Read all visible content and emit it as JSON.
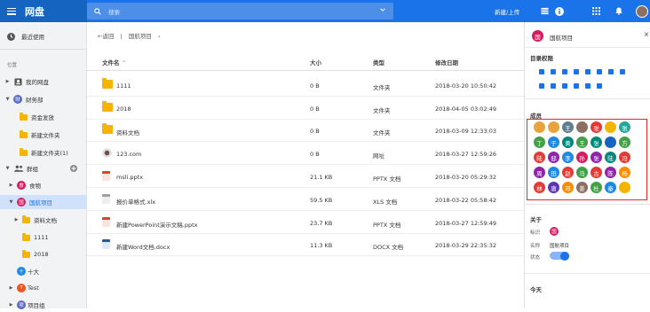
{
  "app": {
    "name": "网盘",
    "search_placeholder": "搜索",
    "new_upload": "新建/上传"
  },
  "colors": {
    "topbar": "#1a73e8",
    "accent": "#1a73e8",
    "folder": "#f4b400",
    "selection": "#cfe1fb",
    "highlight_box": "#d93025"
  },
  "sidebar": {
    "recent": "最近使用",
    "location_label": "位置",
    "my_drive": "我的网盘",
    "dept_avatar": "财",
    "dept": "财务部",
    "dept_folders": [
      "资金发放",
      "新建文件夹",
      "新建文件夹(1)"
    ],
    "groups": "群组",
    "g_shiwu_avatar": "食",
    "g_shiwu": "食物",
    "g_guohang_avatar": "国",
    "g_guohang": "国航项目",
    "sub_folders": [
      "资料文档",
      "1111",
      "2018"
    ],
    "g_shida_avatar": "十",
    "g_shida": "十大",
    "g_test_avatar": "T",
    "g_test": "Test",
    "g_xiangmu_avatar": "项",
    "g_xiangmu": "项目组"
  },
  "breadcrumb": {
    "back": "返回",
    "sep": "|",
    "current": "国航项目",
    "chevron": "›"
  },
  "table": {
    "headers": {
      "name": "文件名",
      "sort": "⌃",
      "size": "大小",
      "type": "类型",
      "date": "修改日期"
    },
    "rows": [
      {
        "name": "1111",
        "size": "0 B",
        "type": "文件夹",
        "date": "2018-03-20 10:50:42",
        "icon": "folder-icon"
      },
      {
        "name": "2018",
        "size": "0 B",
        "type": "文件夹",
        "date": "2018-04-05 03:02:49",
        "icon": "folder-icon"
      },
      {
        "name": "资料文档",
        "size": "0 B",
        "type": "文件夹",
        "date": "2018-03-09 12:33:03",
        "icon": "folder-icon"
      },
      {
        "name": "123.com",
        "size": "0 B",
        "type": "网址",
        "date": "2018-03-27 12:59:26",
        "icon": "link-icon"
      },
      {
        "name": "msli.pptx",
        "size": "21.1 KB",
        "type": "PPTX 文档",
        "date": "2018-03-20 05:29:32",
        "icon": "pptx-icon"
      },
      {
        "name": "报价单格式.xlx",
        "size": "59.5 KB",
        "type": "XLS 文档",
        "date": "2018-03-22 05:58:42",
        "icon": "xls-icon"
      },
      {
        "name": "新建PowerPoint演示文稿.pptx",
        "size": "23.7 KB",
        "type": "PPTX 文档",
        "date": "2018-03-27 12:59:49",
        "icon": "pptx-icon"
      },
      {
        "name": "新建Word文档.docx",
        "size": "11.3 KB",
        "type": "DOCX 文档",
        "date": "2018-03-29 22:35:32",
        "icon": "docx-icon"
      }
    ]
  },
  "panel": {
    "avatar": "国",
    "title": "国航项目",
    "close": "×",
    "perm_title": "目录权限",
    "perm_icons": [
      "view-icon",
      "share-icon",
      "copy-icon",
      "delete-icon",
      "rename-icon",
      "edit-icon",
      "download-icon",
      "upload-icon",
      "copy2-icon",
      "move-icon",
      "upload2-icon",
      "folder-icon",
      "link-icon",
      "check-icon"
    ],
    "members_title": "成员",
    "members": [
      {
        "t": "",
        "c": "#e8a33d"
      },
      {
        "t": "",
        "c": "#e8a33d"
      },
      {
        "t": "王",
        "c": "#607d8b"
      },
      {
        "t": "",
        "c": "#8d6e63"
      },
      {
        "t": "张",
        "c": "#e53935"
      },
      {
        "t": "",
        "c": "#f4b400"
      },
      {
        "t": "张",
        "c": "#26a69a"
      },
      {
        "t": "丁",
        "c": "#43a047"
      },
      {
        "t": "于",
        "c": "#1e88e5"
      },
      {
        "t": "黄",
        "c": "#00897b"
      },
      {
        "t": "王",
        "c": "#43a047"
      },
      {
        "t": "张",
        "c": "#00897b"
      },
      {
        "t": "",
        "c": "#1565c0"
      },
      {
        "t": "方",
        "c": "#43a047"
      },
      {
        "t": "陆",
        "c": "#e53935"
      },
      {
        "t": "邸",
        "c": "#8e24aa"
      },
      {
        "t": "李",
        "c": "#1e88e5"
      },
      {
        "t": "孙",
        "c": "#d81b60"
      },
      {
        "t": "张",
        "c": "#8e24aa"
      },
      {
        "t": "陆",
        "c": "#00897b"
      },
      {
        "t": "冯",
        "c": "#e53935"
      },
      {
        "t": "周",
        "c": "#8e24aa"
      },
      {
        "t": "田",
        "c": "#1e88e5"
      },
      {
        "t": "赵",
        "c": "#e53935"
      },
      {
        "t": "马",
        "c": "#43a047"
      },
      {
        "t": "古",
        "c": "#e53935"
      },
      {
        "t": "陈",
        "c": "#8e24aa"
      },
      {
        "t": "杨",
        "c": "#fb8c00"
      },
      {
        "t": "林",
        "c": "#e53935"
      },
      {
        "t": "唐",
        "c": "#5e35b1"
      },
      {
        "t": "邓",
        "c": "#fb8c00"
      },
      {
        "t": "姜",
        "c": "#8d6e63"
      },
      {
        "t": "杜",
        "c": "#43a047"
      },
      {
        "t": "秦",
        "c": "#1e88e5"
      },
      {
        "t": "",
        "c": "#f4b400"
      }
    ],
    "about_title": "关于",
    "label_id": "标识",
    "id_avatar": "国",
    "label_name": "名称",
    "name_value": "国航项目",
    "label_status": "状态",
    "today_title": "今天"
  }
}
